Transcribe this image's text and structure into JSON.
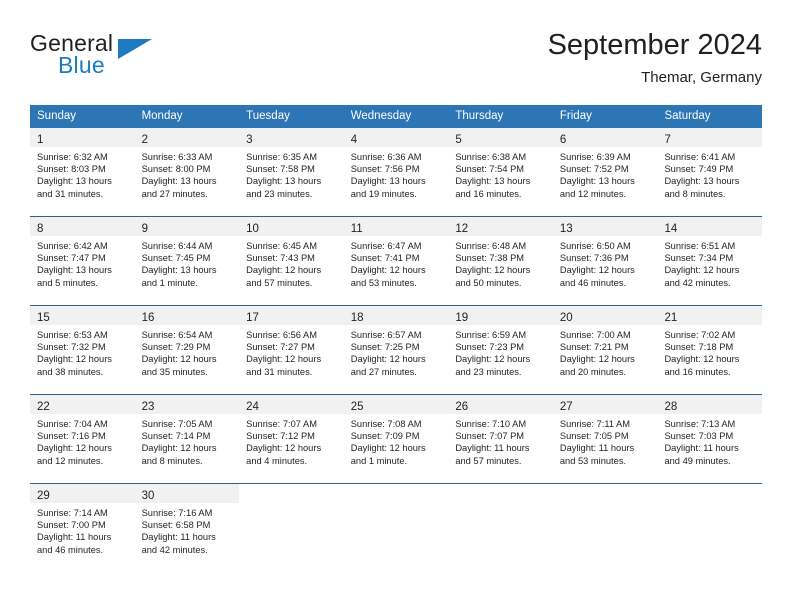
{
  "brand": {
    "name_part1": "General",
    "name_part2": "Blue",
    "accent_color": "#1c7bc0",
    "flag_icon": "blue-triangle-flag-icon"
  },
  "header": {
    "title": "September 2024",
    "subtitle": "Themar, Germany"
  },
  "theme": {
    "header_blue": "#2e75b6",
    "week_divider": "#2f5f8a",
    "daynum_band": "#f1f1f1",
    "text": "#231f20"
  },
  "weekdays": [
    "Sunday",
    "Monday",
    "Tuesday",
    "Wednesday",
    "Thursday",
    "Friday",
    "Saturday"
  ],
  "weeks": [
    [
      {
        "day": "1",
        "sunrise": "Sunrise: 6:32 AM",
        "sunset": "Sunset: 8:03 PM",
        "daylight_line1": "Daylight: 13 hours",
        "daylight_line2": "and 31 minutes."
      },
      {
        "day": "2",
        "sunrise": "Sunrise: 6:33 AM",
        "sunset": "Sunset: 8:00 PM",
        "daylight_line1": "Daylight: 13 hours",
        "daylight_line2": "and 27 minutes."
      },
      {
        "day": "3",
        "sunrise": "Sunrise: 6:35 AM",
        "sunset": "Sunset: 7:58 PM",
        "daylight_line1": "Daylight: 13 hours",
        "daylight_line2": "and 23 minutes."
      },
      {
        "day": "4",
        "sunrise": "Sunrise: 6:36 AM",
        "sunset": "Sunset: 7:56 PM",
        "daylight_line1": "Daylight: 13 hours",
        "daylight_line2": "and 19 minutes."
      },
      {
        "day": "5",
        "sunrise": "Sunrise: 6:38 AM",
        "sunset": "Sunset: 7:54 PM",
        "daylight_line1": "Daylight: 13 hours",
        "daylight_line2": "and 16 minutes."
      },
      {
        "day": "6",
        "sunrise": "Sunrise: 6:39 AM",
        "sunset": "Sunset: 7:52 PM",
        "daylight_line1": "Daylight: 13 hours",
        "daylight_line2": "and 12 minutes."
      },
      {
        "day": "7",
        "sunrise": "Sunrise: 6:41 AM",
        "sunset": "Sunset: 7:49 PM",
        "daylight_line1": "Daylight: 13 hours",
        "daylight_line2": "and 8 minutes."
      }
    ],
    [
      {
        "day": "8",
        "sunrise": "Sunrise: 6:42 AM",
        "sunset": "Sunset: 7:47 PM",
        "daylight_line1": "Daylight: 13 hours",
        "daylight_line2": "and 5 minutes."
      },
      {
        "day": "9",
        "sunrise": "Sunrise: 6:44 AM",
        "sunset": "Sunset: 7:45 PM",
        "daylight_line1": "Daylight: 13 hours",
        "daylight_line2": "and 1 minute."
      },
      {
        "day": "10",
        "sunrise": "Sunrise: 6:45 AM",
        "sunset": "Sunset: 7:43 PM",
        "daylight_line1": "Daylight: 12 hours",
        "daylight_line2": "and 57 minutes."
      },
      {
        "day": "11",
        "sunrise": "Sunrise: 6:47 AM",
        "sunset": "Sunset: 7:41 PM",
        "daylight_line1": "Daylight: 12 hours",
        "daylight_line2": "and 53 minutes."
      },
      {
        "day": "12",
        "sunrise": "Sunrise: 6:48 AM",
        "sunset": "Sunset: 7:38 PM",
        "daylight_line1": "Daylight: 12 hours",
        "daylight_line2": "and 50 minutes."
      },
      {
        "day": "13",
        "sunrise": "Sunrise: 6:50 AM",
        "sunset": "Sunset: 7:36 PM",
        "daylight_line1": "Daylight: 12 hours",
        "daylight_line2": "and 46 minutes."
      },
      {
        "day": "14",
        "sunrise": "Sunrise: 6:51 AM",
        "sunset": "Sunset: 7:34 PM",
        "daylight_line1": "Daylight: 12 hours",
        "daylight_line2": "and 42 minutes."
      }
    ],
    [
      {
        "day": "15",
        "sunrise": "Sunrise: 6:53 AM",
        "sunset": "Sunset: 7:32 PM",
        "daylight_line1": "Daylight: 12 hours",
        "daylight_line2": "and 38 minutes."
      },
      {
        "day": "16",
        "sunrise": "Sunrise: 6:54 AM",
        "sunset": "Sunset: 7:29 PM",
        "daylight_line1": "Daylight: 12 hours",
        "daylight_line2": "and 35 minutes."
      },
      {
        "day": "17",
        "sunrise": "Sunrise: 6:56 AM",
        "sunset": "Sunset: 7:27 PM",
        "daylight_line1": "Daylight: 12 hours",
        "daylight_line2": "and 31 minutes."
      },
      {
        "day": "18",
        "sunrise": "Sunrise: 6:57 AM",
        "sunset": "Sunset: 7:25 PM",
        "daylight_line1": "Daylight: 12 hours",
        "daylight_line2": "and 27 minutes."
      },
      {
        "day": "19",
        "sunrise": "Sunrise: 6:59 AM",
        "sunset": "Sunset: 7:23 PM",
        "daylight_line1": "Daylight: 12 hours",
        "daylight_line2": "and 23 minutes."
      },
      {
        "day": "20",
        "sunrise": "Sunrise: 7:00 AM",
        "sunset": "Sunset: 7:21 PM",
        "daylight_line1": "Daylight: 12 hours",
        "daylight_line2": "and 20 minutes."
      },
      {
        "day": "21",
        "sunrise": "Sunrise: 7:02 AM",
        "sunset": "Sunset: 7:18 PM",
        "daylight_line1": "Daylight: 12 hours",
        "daylight_line2": "and 16 minutes."
      }
    ],
    [
      {
        "day": "22",
        "sunrise": "Sunrise: 7:04 AM",
        "sunset": "Sunset: 7:16 PM",
        "daylight_line1": "Daylight: 12 hours",
        "daylight_line2": "and 12 minutes."
      },
      {
        "day": "23",
        "sunrise": "Sunrise: 7:05 AM",
        "sunset": "Sunset: 7:14 PM",
        "daylight_line1": "Daylight: 12 hours",
        "daylight_line2": "and 8 minutes."
      },
      {
        "day": "24",
        "sunrise": "Sunrise: 7:07 AM",
        "sunset": "Sunset: 7:12 PM",
        "daylight_line1": "Daylight: 12 hours",
        "daylight_line2": "and 4 minutes."
      },
      {
        "day": "25",
        "sunrise": "Sunrise: 7:08 AM",
        "sunset": "Sunset: 7:09 PM",
        "daylight_line1": "Daylight: 12 hours",
        "daylight_line2": "and 1 minute."
      },
      {
        "day": "26",
        "sunrise": "Sunrise: 7:10 AM",
        "sunset": "Sunset: 7:07 PM",
        "daylight_line1": "Daylight: 11 hours",
        "daylight_line2": "and 57 minutes."
      },
      {
        "day": "27",
        "sunrise": "Sunrise: 7:11 AM",
        "sunset": "Sunset: 7:05 PM",
        "daylight_line1": "Daylight: 11 hours",
        "daylight_line2": "and 53 minutes."
      },
      {
        "day": "28",
        "sunrise": "Sunrise: 7:13 AM",
        "sunset": "Sunset: 7:03 PM",
        "daylight_line1": "Daylight: 11 hours",
        "daylight_line2": "and 49 minutes."
      }
    ],
    [
      {
        "day": "29",
        "sunrise": "Sunrise: 7:14 AM",
        "sunset": "Sunset: 7:00 PM",
        "daylight_line1": "Daylight: 11 hours",
        "daylight_line2": "and 46 minutes."
      },
      {
        "day": "30",
        "sunrise": "Sunrise: 7:16 AM",
        "sunset": "Sunset: 6:58 PM",
        "daylight_line1": "Daylight: 11 hours",
        "daylight_line2": "and 42 minutes."
      },
      {
        "day": "",
        "sunrise": "",
        "sunset": "",
        "daylight_line1": "",
        "daylight_line2": ""
      },
      {
        "day": "",
        "sunrise": "",
        "sunset": "",
        "daylight_line1": "",
        "daylight_line2": ""
      },
      {
        "day": "",
        "sunrise": "",
        "sunset": "",
        "daylight_line1": "",
        "daylight_line2": ""
      },
      {
        "day": "",
        "sunrise": "",
        "sunset": "",
        "daylight_line1": "",
        "daylight_line2": ""
      },
      {
        "day": "",
        "sunrise": "",
        "sunset": "",
        "daylight_line1": "",
        "daylight_line2": ""
      }
    ]
  ]
}
